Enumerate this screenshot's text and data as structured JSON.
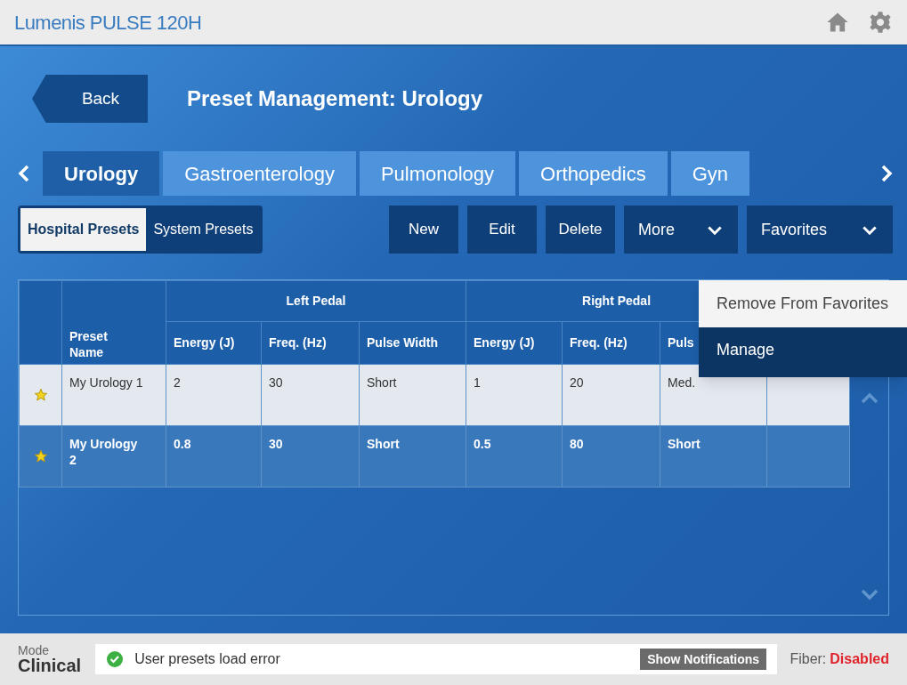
{
  "header": {
    "brand": "Lumenis PULSE 120H"
  },
  "title_bar": {
    "back": "Back",
    "title": "Preset Management: Urology"
  },
  "tabs": [
    {
      "label": "Urology",
      "selected": true
    },
    {
      "label": "Gastroenterology",
      "selected": false
    },
    {
      "label": "Pulmonology",
      "selected": false
    },
    {
      "label": "Orthopedics",
      "selected": false
    },
    {
      "label": "Gyn",
      "selected": false
    }
  ],
  "preset_toggle": [
    {
      "label": "Hospital Presets",
      "selected": true
    },
    {
      "label": "System Presets",
      "selected": false
    }
  ],
  "actions": [
    {
      "label": "New",
      "kind": "plain"
    },
    {
      "label": "Edit",
      "kind": "plain"
    },
    {
      "label": "Delete",
      "kind": "plain"
    },
    {
      "label": "More",
      "kind": "dropdown"
    },
    {
      "label": "Favorites",
      "kind": "dropdown"
    }
  ],
  "favorites_menu": [
    {
      "label": "Remove From Favorites",
      "selected": true
    },
    {
      "label": "Manage",
      "selected": false
    }
  ],
  "table": {
    "groups": [
      "Left Pedal",
      "Right Pedal"
    ],
    "columns": [
      "Preset Name",
      "Energy (J)",
      "Freq. (Hz)",
      "Pulse Width",
      "Energy (J)",
      "Freq. (Hz)",
      "Puls"
    ],
    "rows": [
      {
        "favorite": true,
        "selected": true,
        "cells": [
          "My Urology 1",
          "2",
          "30",
          "Short",
          "1",
          "20",
          "Med."
        ]
      },
      {
        "favorite": true,
        "selected": false,
        "cells": [
          "My Urology 2",
          "0.8",
          "30",
          "Short",
          "0.5",
          "80",
          "Short"
        ]
      }
    ]
  },
  "status_bar": {
    "mode_label": "Mode",
    "mode": "Clinical",
    "message": "User presets load error",
    "notifications_button": "Show Notifications",
    "fiber_label": "Fiber:",
    "fiber_status": "Disabled"
  }
}
